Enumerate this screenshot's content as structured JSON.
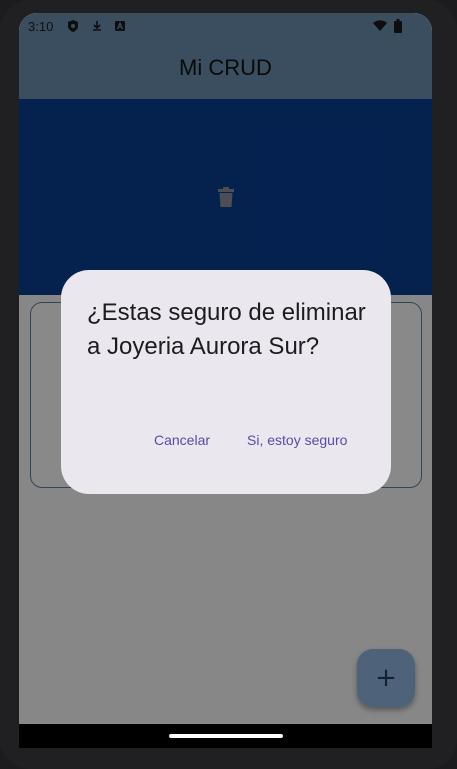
{
  "status_bar": {
    "time": "3:10",
    "left_icons": [
      "shield-icon",
      "download-icon",
      "font-icon"
    ],
    "right_icons": [
      "wifi-icon",
      "battery-icon"
    ]
  },
  "app_bar": {
    "title": "Mi CRUD"
  },
  "colors": {
    "app_bar": "#6a8fb0",
    "delete_background": "#0a3d8f",
    "dialog_background": "#ebe7ee",
    "dialog_action": "#5b4aa8",
    "fab": "#8fb4dc"
  },
  "list": {
    "swipe_action_icon": "trash-icon"
  },
  "fab": {
    "icon": "plus-icon",
    "label": "+"
  },
  "dialog": {
    "message": "¿Estas seguro de eliminar a Joyeria Aurora Sur?",
    "cancel_label": "Cancelar",
    "confirm_label": "Si, estoy seguro"
  }
}
